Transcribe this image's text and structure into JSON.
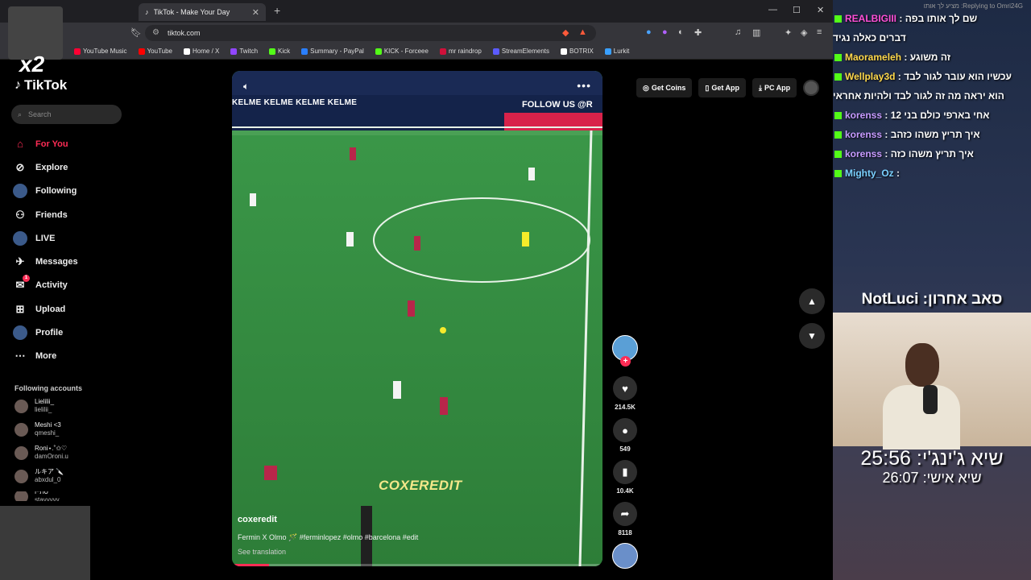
{
  "browser": {
    "tab_title": "TikTok - Make Your Day",
    "url": "tiktok.com",
    "bookmarks": [
      {
        "label": "YouTube Music",
        "color": "#ff0033"
      },
      {
        "label": "YouTube",
        "color": "#ff0000"
      },
      {
        "label": "Home / X",
        "color": "#ffffff"
      },
      {
        "label": "Twitch",
        "color": "#9146ff"
      },
      {
        "label": "Kick",
        "color": "#53fc18"
      },
      {
        "label": "Summary - PayPal",
        "color": "#2a7fff"
      },
      {
        "label": "KICK - Forceee",
        "color": "#53fc18"
      },
      {
        "label": "mr raindrop",
        "color": "#d0103a"
      },
      {
        "label": "StreamElements",
        "color": "#5b5bff"
      },
      {
        "label": "BOTRIX",
        "color": "#ffffff"
      },
      {
        "label": "Lurkit",
        "color": "#3aa0ff"
      }
    ]
  },
  "sidebar": {
    "logo": "TikTok",
    "search_placeholder": "Search",
    "nav": [
      {
        "label": "For You",
        "icon": "home-icon",
        "active": true
      },
      {
        "label": "Explore",
        "icon": "compass-icon"
      },
      {
        "label": "Following",
        "icon": "following-avatar-icon"
      },
      {
        "label": "Friends",
        "icon": "friends-icon"
      },
      {
        "label": "LIVE",
        "icon": "live-icon"
      },
      {
        "label": "Messages",
        "icon": "messages-icon"
      },
      {
        "label": "Activity",
        "icon": "activity-icon",
        "badge": "1"
      },
      {
        "label": "Upload",
        "icon": "upload-icon"
      },
      {
        "label": "Profile",
        "icon": "profile-icon"
      },
      {
        "label": "More",
        "icon": "more-icon"
      }
    ],
    "following_title": "Following accounts",
    "accounts": [
      {
        "name": "Lielilii_",
        "handle": "lielilii_"
      },
      {
        "name": "Meshi <3",
        "handle": "qmeshi_"
      },
      {
        "name": "Roni⋆.˚✩♡",
        "handle": "damOroni.u"
      },
      {
        "name": "ルキア 🔪",
        "handle": "abxdul_0"
      },
      {
        "name": "סתייו",
        "handle": "stayyyyy"
      }
    ]
  },
  "video": {
    "banner_text": "KELME   KELME   KELME   KELME",
    "banner_right": "FOLLOW US @R",
    "watermark": "COXEREDIT",
    "author": "coxeredit",
    "caption": "Fermin X Olmo 🪄 #ferminlopez #olmo #barcelona #edit",
    "see_translation": "See translation",
    "progress": 0.1
  },
  "actions": {
    "likes": "214.5K",
    "comments": "549",
    "saves": "10.4K",
    "shares": "8118"
  },
  "topbar": {
    "get_coins": "Get Coins",
    "get_app": "Get App",
    "pc_app": "PC App"
  },
  "stream": {
    "reply_header": "Replying to Omri24G: מציע לך אותו",
    "chat": [
      {
        "user": "REALBIGIII",
        "text": "שם לך אותו בפה",
        "color": "#ff4fd8"
      },
      {
        "user": "",
        "text": "דברים כאלה נגיד",
        "color": "#ffffff"
      },
      {
        "user": "Maorameleh",
        "text": "זה משוגע",
        "color": "#ffd84a"
      },
      {
        "user": "Wellplay3d",
        "text": "עכשיו הוא עובר לגור לבד",
        "color": "#ffd84a"
      },
      {
        "user": "",
        "text": "הוא יראה מה זה לגור לבד ולהיות אחראי",
        "color": "#ffffff"
      },
      {
        "user": "korenss",
        "text": "אחי בארפי כולם בני 12",
        "color": "#c79bff"
      },
      {
        "user": "korenss",
        "text": "איך תריץ משהו כזהב",
        "color": "#c79bff"
      },
      {
        "user": "korenss",
        "text": "איך תריץ משהו כזה",
        "color": "#c79bff"
      },
      {
        "user": "Mighty_Oz",
        "text": "",
        "color": "#7ad0ff"
      }
    ],
    "announce": "NotLuci :סאב אחרון",
    "timer_main": "שיא ג'ינג'י: 25:56",
    "timer_sub": "שיא אישי: 26:07"
  },
  "overlay": {
    "multiplier": "x2"
  }
}
